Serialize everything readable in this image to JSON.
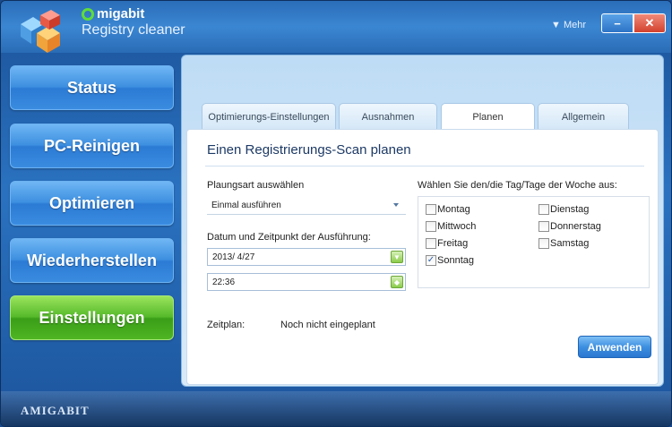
{
  "app": {
    "brand_name": "migabit",
    "product_name": "Registry cleaner",
    "more_label": "▼ Mehr",
    "minimize_label": "−",
    "close_label": "✕",
    "footer_brand": "AMIGABIT"
  },
  "sidebar": {
    "items": [
      {
        "label": "Status",
        "active": false
      },
      {
        "label": "PC-Reinigen",
        "active": false
      },
      {
        "label": "Optimieren",
        "active": false
      },
      {
        "label": "Wiederherstellen",
        "active": false
      },
      {
        "label": "Einstellungen",
        "active": true
      }
    ]
  },
  "tabs": [
    {
      "label": "Optimierungs-Einstellungen",
      "active": false
    },
    {
      "label": "Ausnahmen",
      "active": false
    },
    {
      "label": "Planen",
      "active": true
    },
    {
      "label": "Allgemein",
      "active": false
    }
  ],
  "schedule": {
    "title": "Einen Registrierungs-Scan planen",
    "plan_type_label": "Plaungsart auswählen",
    "plan_type_value": "Einmal ausführen",
    "datetime_label": "Datum und Zeitpunkt der Ausführung:",
    "date_value": "2013/ 4/27",
    "time_value": "22:36",
    "days_label": "Wählen Sie den/die Tag/Tage der Woche aus:",
    "days": [
      {
        "label": "Montag",
        "checked": false
      },
      {
        "label": "Dienstag",
        "checked": false
      },
      {
        "label": "Mittwoch",
        "checked": false
      },
      {
        "label": "Donnerstag",
        "checked": false
      },
      {
        "label": "Freitag",
        "checked": false
      },
      {
        "label": "Samstag",
        "checked": false
      },
      {
        "label": "Sonntag",
        "checked": true
      }
    ],
    "status_label": "Zeitplan:",
    "status_value": "Noch nicht eingeplant",
    "apply_label": "Anwenden"
  }
}
